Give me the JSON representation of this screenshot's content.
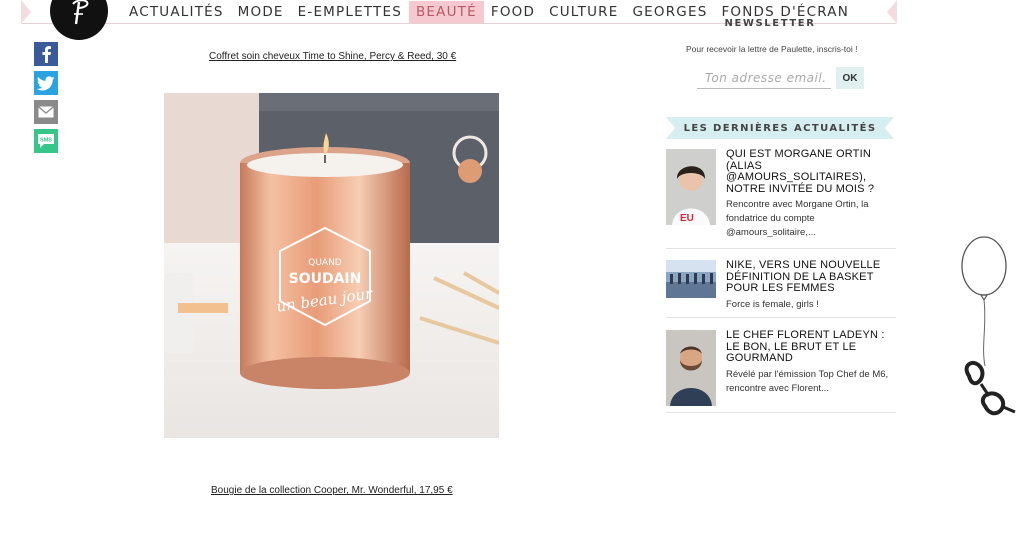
{
  "nav": {
    "items": [
      {
        "label": "ACTUALITÉS"
      },
      {
        "label": "MODE"
      },
      {
        "label": "E-EMPLETTES"
      },
      {
        "label": "BEAUTÉ",
        "active": true
      },
      {
        "label": "FOOD"
      },
      {
        "label": "CULTURE"
      },
      {
        "label": "GEORGES"
      },
      {
        "label": "FONDS D'ÉCRAN"
      }
    ]
  },
  "share": {
    "buttons": [
      {
        "icon": "facebook-icon"
      },
      {
        "icon": "twitter-icon"
      },
      {
        "icon": "mail-icon"
      },
      {
        "icon": "sms-icon",
        "label": "SMS"
      }
    ]
  },
  "article": {
    "caption_top": "Coffret soin cheveux Time to Shine, Percy & Reed, 30 €",
    "caption_bottom": "Bougie de la collection Cooper, Mr. Wonderful, 17,95 €",
    "candle_text": {
      "line1": "QUAND",
      "line2": "SOUDAIN",
      "line3": "un beau jour"
    }
  },
  "newsletter": {
    "title": "NEWSLETTER",
    "text": "Pour recevoir la lettre de Paulette, inscris-toi !",
    "placeholder": "Ton adresse email.",
    "button": "OK"
  },
  "latest": {
    "title": "LES DERNIÈRES ACTUALITÉS",
    "items": [
      {
        "title": "QUI EST MORGANE ORTIN (ALIAS @AMOURS_SOLITAIRES), NOTRE INVITÉE DU MOIS ?",
        "excerpt": "Rencontre avec Morgane Ortin, la fondatrice du compte @amours_solitaire,...",
        "thumb_text": "EU"
      },
      {
        "title": "NIKE, VERS UNE NOUVELLE DÉFINITION DE LA BASKET POUR LES FEMMES",
        "excerpt": "Force is female, girls !"
      },
      {
        "title": "LE CHEF FLORENT LADEYN : LE BON, LE BRUT ET LE GOURMAND",
        "excerpt": "Révélé par l'émission Top Chef de M6, rencontre avec Florent..."
      }
    ]
  },
  "colors": {
    "accent_pink": "#f6c8cf",
    "accent_teal": "#d7eef0",
    "facebook": "#3b5a9a",
    "twitter": "#2aa3e0",
    "sms": "#36c68a"
  }
}
